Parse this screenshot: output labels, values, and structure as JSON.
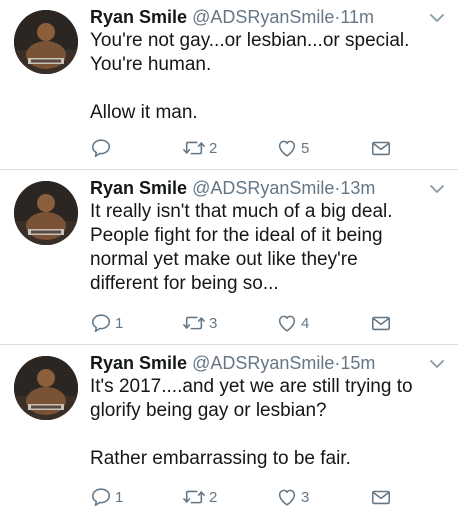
{
  "tweets": [
    {
      "name": "Ryan Smile",
      "handle": "@ADSRyanSmile",
      "separator": "·",
      "time": "11m",
      "lines": [
        "You're not gay...or lesbian...or special.",
        "You're human."
      ],
      "lines2": [
        "Allow it man."
      ],
      "reply_count": "",
      "retweet_count": "2",
      "like_count": "5"
    },
    {
      "name": "Ryan Smile",
      "handle": "@ADSRyanSmile",
      "separator": "·",
      "time": "13m",
      "lines": [
        "It really isn't that much of a big deal.",
        "People fight for the ideal of it being",
        "normal yet make out like they're",
        "different for being so..."
      ],
      "lines2": [],
      "reply_count": "1",
      "retweet_count": "3",
      "like_count": "4"
    },
    {
      "name": "Ryan Smile",
      "handle": "@ADSRyanSmile",
      "separator": "·",
      "time": "15m",
      "lines": [
        "It's 2017....and yet we are still trying to",
        "glorify being gay or lesbian?"
      ],
      "lines2": [
        "Rather embarrassing to be fair."
      ],
      "reply_count": "1",
      "retweet_count": "2",
      "like_count": "3"
    }
  ],
  "icons": {
    "reply": "reply-icon",
    "retweet": "retweet-icon",
    "like": "heart-icon",
    "message": "envelope-icon",
    "more": "chevron-down-icon"
  },
  "colors": {
    "text": "#14171a",
    "muted": "#657786",
    "divider": "#d8dde1"
  }
}
